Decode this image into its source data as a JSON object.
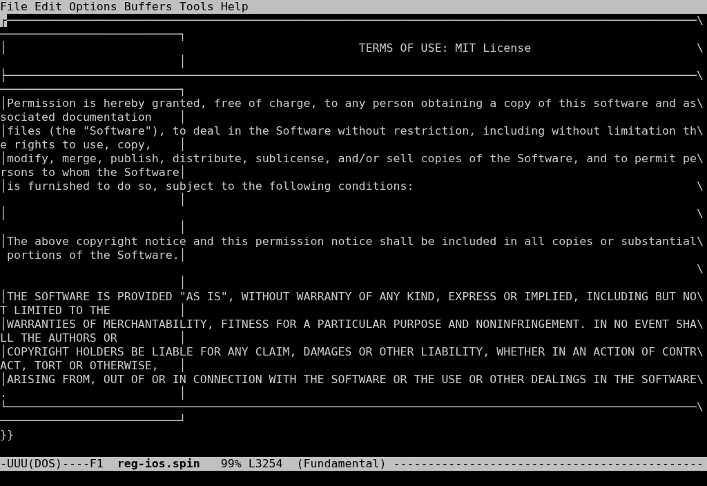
{
  "menu_bar": [
    {
      "label": "File"
    },
    {
      "label": "Edit"
    },
    {
      "label": "Options"
    },
    {
      "label": "Buffers"
    },
    {
      "label": "Tools"
    },
    {
      "label": "Help"
    }
  ],
  "buffer_lines": [
    {
      "text": "┌────────────────────────────────────────────────────────────────────────────────────────────────────\\",
      "cursor": true
    },
    {
      "text": "──────────────────────────┐",
      "cursor": false
    },
    {
      "text": "│                                                   TERMS OF USE: MIT License                        \\",
      "cursor": false
    },
    {
      "text": "                          │",
      "cursor": false
    },
    {
      "text": "├────────────────────────────────────────────────────────────────────────────────────────────────────\\",
      "cursor": false
    },
    {
      "text": "──────────────────────────┐",
      "cursor": false
    },
    {
      "text": "│Permission is hereby granted, free of charge, to any person obtaining a copy of this software and as\\",
      "cursor": false
    },
    {
      "text": "sociated documentation    │",
      "cursor": false
    },
    {
      "text": "│files (the \"Software\"), to deal in the Software without restriction, including without limitation th\\",
      "cursor": false
    },
    {
      "text": "e rights to use, copy,    │",
      "cursor": false
    },
    {
      "text": "│modify, merge, publish, distribute, sublicense, and/or sell copies of the Software, and to permit pe\\",
      "cursor": false
    },
    {
      "text": "rsons to whom the Software│",
      "cursor": false
    },
    {
      "text": "│is furnished to do so, subject to the following conditions:                                         \\",
      "cursor": false
    },
    {
      "text": "                          │",
      "cursor": false
    },
    {
      "text": "│                                                                                                    \\",
      "cursor": false
    },
    {
      "text": "                          │",
      "cursor": false
    },
    {
      "text": "│The above copyright notice and this permission notice shall be included in all copies or substantial\\",
      "cursor": false
    },
    {
      "text": " portions of the Software.│",
      "cursor": false
    },
    {
      "text": "                                                                                                     \\",
      "cursor": false
    },
    {
      "text": "                          │",
      "cursor": false
    },
    {
      "text": "│THE SOFTWARE IS PROVIDED \"AS IS\", WITHOUT WARRANTY OF ANY KIND, EXPRESS OR IMPLIED, INCLUDING BUT NO\\",
      "cursor": false
    },
    {
      "text": "T LIMITED TO THE          │",
      "cursor": false
    },
    {
      "text": "│WARRANTIES OF MERCHANTABILITY, FITNESS FOR A PARTICULAR PURPOSE AND NONINFRINGEMENT. IN NO EVENT SHA\\",
      "cursor": false
    },
    {
      "text": "LL THE AUTHORS OR         │",
      "cursor": false
    },
    {
      "text": "│COPYRIGHT HOLDERS BE LIABLE FOR ANY CLAIM, DAMAGES OR OTHER LIABILITY, WHETHER IN AN ACTION OF CONTR\\",
      "cursor": false
    },
    {
      "text": "ACT, TORT OR OTHERWISE,   │",
      "cursor": false
    },
    {
      "text": "│ARISING FROM, OUT OF OR IN CONNECTION WITH THE SOFTWARE OR THE USE OR OTHER DEALINGS IN THE SOFTWARE\\",
      "cursor": false
    },
    {
      "text": ".                         │",
      "cursor": false
    },
    {
      "text": "└────────────────────────────────────────────────────────────────────────────────────────────────────\\",
      "cursor": false
    },
    {
      "text": "──────────────────────────┘",
      "cursor": false
    },
    {
      "text": "}}",
      "cursor": false
    }
  ],
  "mode_line": {
    "status": "-UUU(DOS)----F1",
    "buffer_name": "reg-ios.spin",
    "position": "99% L3254",
    "major_mode": "(Fundamental)",
    "fill": "---------------------------------------------"
  }
}
